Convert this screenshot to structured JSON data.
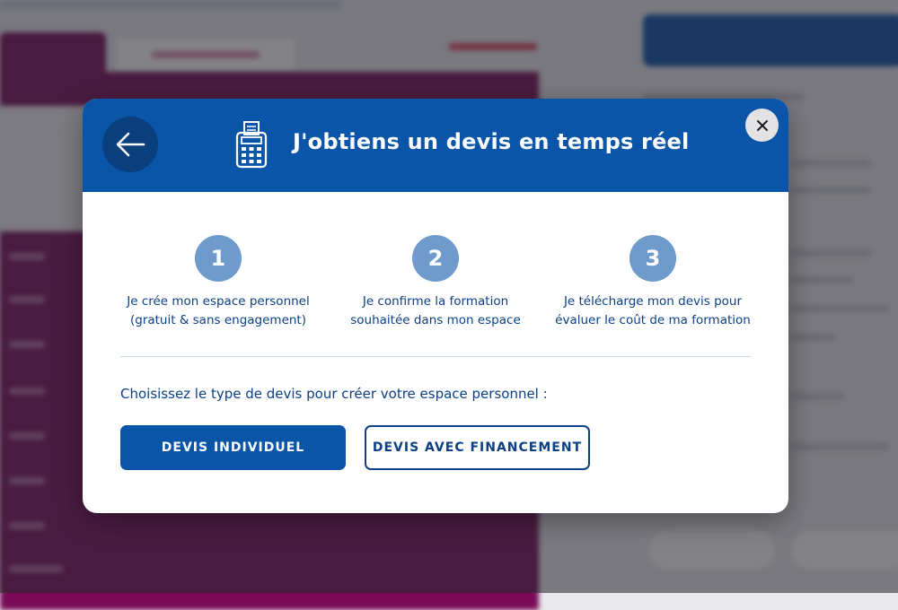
{
  "modal": {
    "title": "J'obtiens un devis en temps réel",
    "back_icon": "arrow-left-icon",
    "header_icon": "calculator-receipt-icon",
    "close_icon": "close-icon",
    "steps": [
      {
        "number": "1",
        "line1": "Je crée mon espace personnel",
        "line2": "(gratuit & sans engagement)"
      },
      {
        "number": "2",
        "line1": "Je confirme la formation",
        "line2": "souhaitée dans mon espace"
      },
      {
        "number": "3",
        "line1": "Je télécharge mon devis pour",
        "line2": "évaluer le coût de ma formation"
      }
    ],
    "choose_label": "Choisissez le type de devis pour créer votre espace personnel :",
    "buttons": {
      "individual": "DEVIS INDIVIDUEL",
      "financing": "DEVIS AVEC FINANCEMENT"
    }
  },
  "colors": {
    "primary": "#0b55a8",
    "step_circle": "#6e9bcb",
    "text_dark_blue": "#0b3f86",
    "background_panel": "#7a0a57"
  }
}
